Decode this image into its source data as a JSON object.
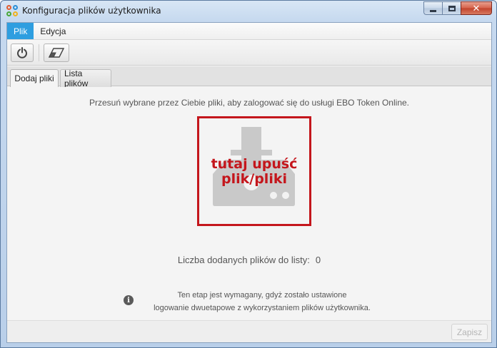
{
  "window": {
    "title": "Konfiguracja plików użytkownika",
    "close_glyph": "✕"
  },
  "menu": {
    "items": [
      {
        "label": "Plik",
        "active": true
      },
      {
        "label": "Edycja",
        "active": false
      }
    ]
  },
  "toolbar": {
    "buttons": [
      {
        "icon": "power-icon"
      },
      {
        "icon": "eraser-icon"
      }
    ]
  },
  "tabs": [
    {
      "label": "Dodaj pliki",
      "active": true
    },
    {
      "label": "Lista plików",
      "active": false
    }
  ],
  "main": {
    "instruction": "Przesuń wybrane przez Ciebie pliki, aby zalogować się do usługi EBO Token Online.",
    "dropzone": {
      "line1": "tutaj upuść",
      "line2": "plik/pliki",
      "icon": "drop-upload-icon",
      "accent_color": "#c4161c"
    },
    "count_label": "Liczba dodanych plików do listy:",
    "count_value": "0",
    "info_icon": "info-icon",
    "info_line1": "Ten etap jest wymagany, gdyż zostało ustawione",
    "info_line2": "logowanie dwuetapowe z wykorzystaniem plików użytkownika."
  },
  "footer": {
    "save_label": "Zapisz",
    "save_enabled": false
  },
  "colors": {
    "menu_active": "#2e9ee0",
    "accent": "#c4161c"
  }
}
